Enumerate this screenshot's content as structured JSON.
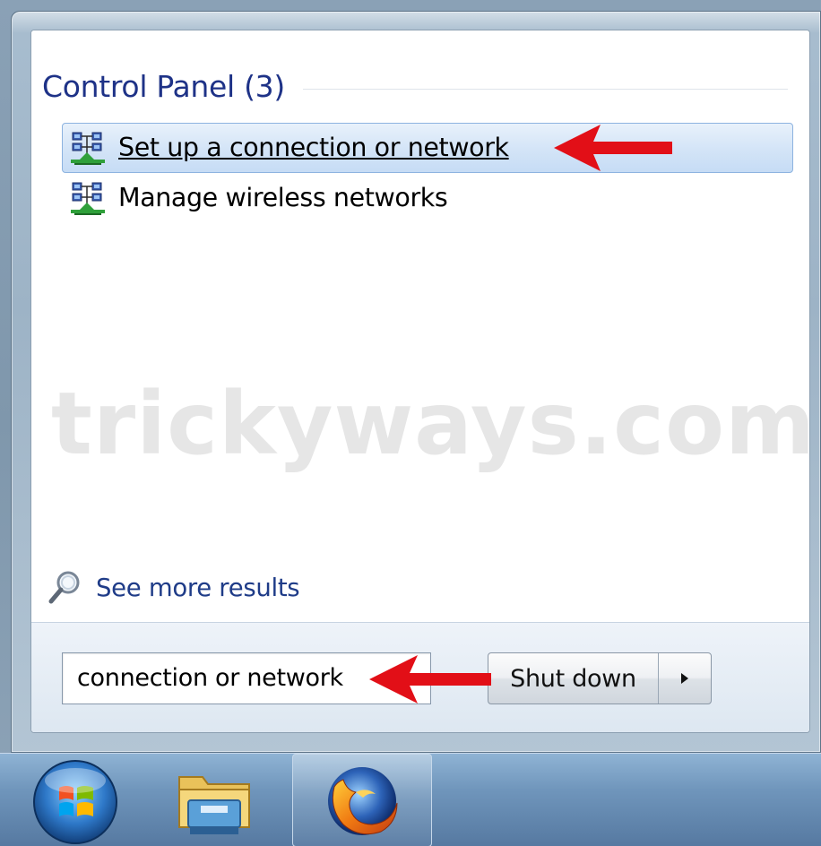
{
  "start_menu": {
    "section_title": "Control Panel (3)",
    "results": [
      {
        "label": "Set up a connection or network",
        "icon": "network-icon",
        "selected": true
      },
      {
        "label": "Manage wireless networks",
        "icon": "network-icon",
        "selected": false
      }
    ],
    "see_more_label": "See more results",
    "search": {
      "value": "connection or network"
    },
    "shutdown": {
      "label": "Shut down",
      "arrow_icon": "chevron-right-icon"
    }
  },
  "watermark": "trickyways.com",
  "taskbar": {
    "items": [
      {
        "icon": "start-orb-icon"
      },
      {
        "icon": "windows-explorer-icon"
      },
      {
        "icon": "firefox-icon",
        "active": true
      }
    ]
  },
  "annotation_color": "#e20f17",
  "colors": {
    "header_text": "#1e3287",
    "selected_item_bg": "#d3e4f7",
    "link_text": "#1f3c88"
  }
}
